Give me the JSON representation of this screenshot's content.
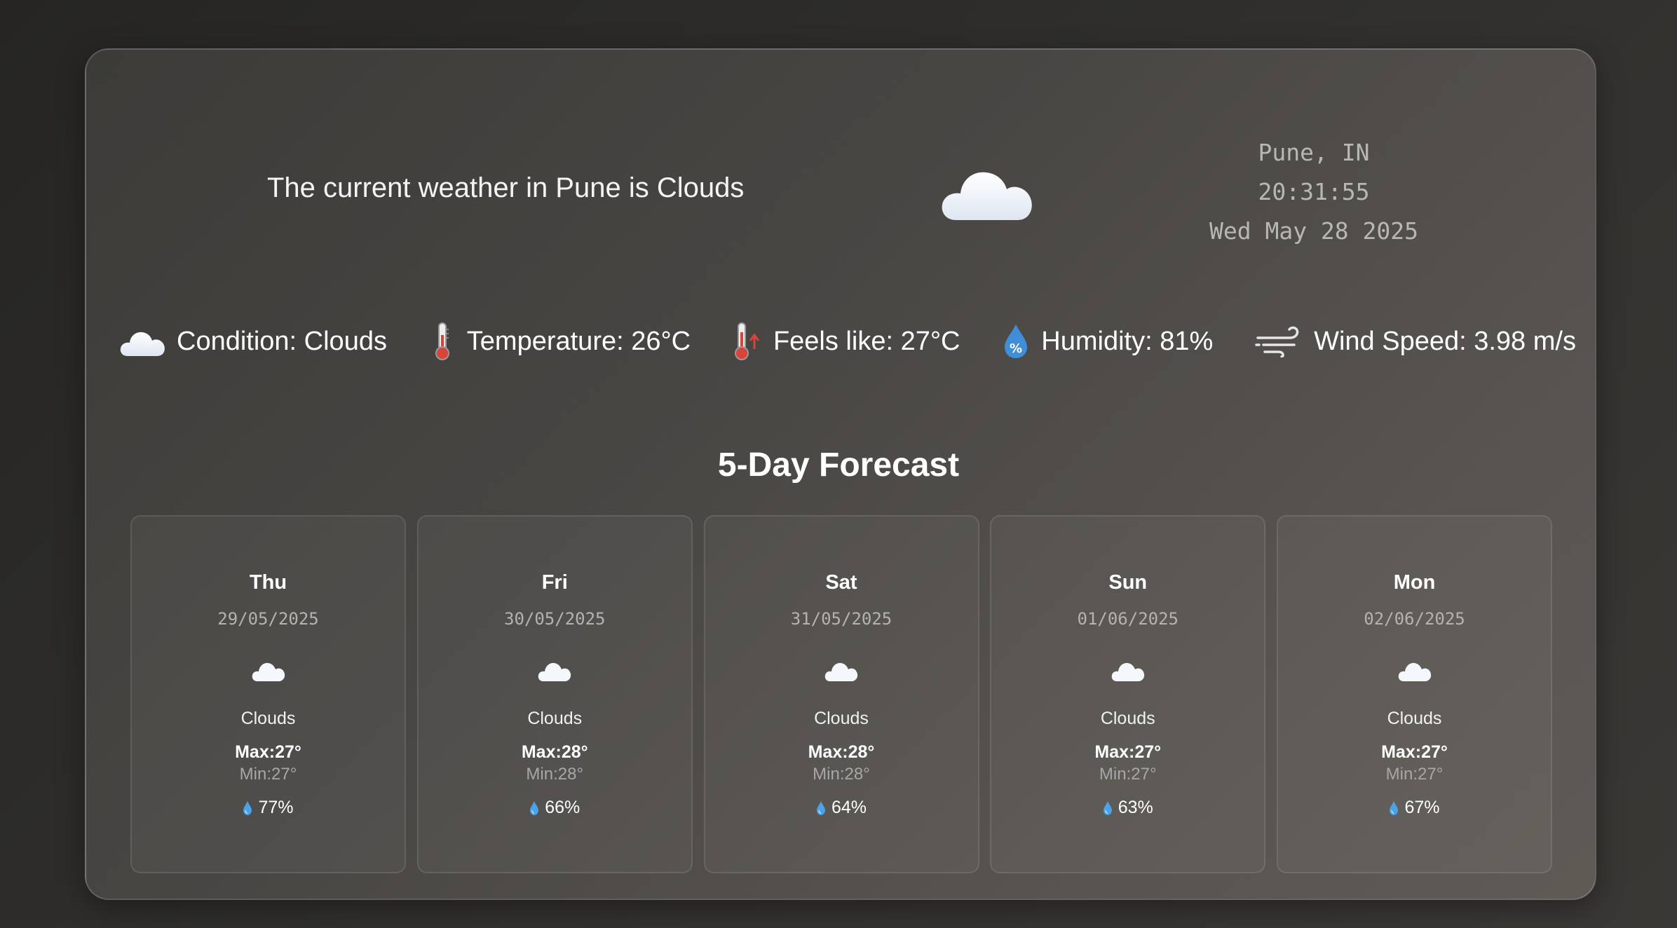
{
  "header": {
    "headline": "The current weather in Pune is Clouds",
    "hero_icon": "cloud-icon",
    "location": "Pune, IN",
    "time": "20:31:55",
    "date": "Wed May 28 2025"
  },
  "stats": {
    "condition": {
      "icon": "cloud-icon",
      "label": "Condition: Clouds"
    },
    "temperature": {
      "icon": "thermometer-icon",
      "label": "Temperature: 26°C"
    },
    "feels_like": {
      "icon": "thermometer-up-icon",
      "label": "Feels like: 27°C"
    },
    "humidity": {
      "icon": "humidity-drop-icon",
      "label": "Humidity: 81%"
    },
    "wind": {
      "icon": "wind-icon",
      "label": "Wind Speed: 3.98 m/s"
    }
  },
  "forecast": {
    "title": "5-Day Forecast",
    "days": [
      {
        "day": "Thu",
        "date": "29/05/2025",
        "icon": "cloud-icon",
        "condition": "Clouds",
        "max": "Max:27°",
        "min": "Min:27°",
        "humidity": "77%"
      },
      {
        "day": "Fri",
        "date": "30/05/2025",
        "icon": "cloud-icon",
        "condition": "Clouds",
        "max": "Max:28°",
        "min": "Min:28°",
        "humidity": "66%"
      },
      {
        "day": "Sat",
        "date": "31/05/2025",
        "icon": "cloud-icon",
        "condition": "Clouds",
        "max": "Max:28°",
        "min": "Min:28°",
        "humidity": "64%"
      },
      {
        "day": "Sun",
        "date": "01/06/2025",
        "icon": "cloud-icon",
        "condition": "Clouds",
        "max": "Max:27°",
        "min": "Min:27°",
        "humidity": "63%"
      },
      {
        "day": "Mon",
        "date": "02/06/2025",
        "icon": "cloud-icon",
        "condition": "Clouds",
        "max": "Max:27°",
        "min": "Min:27°",
        "humidity": "67%"
      }
    ]
  },
  "colors": {
    "background": "#2b2a28",
    "panel": "#4a4845",
    "clock_text": "#b9b7b4",
    "humidity_drop": "#3f8fd8",
    "thermometer_red": "#d9443a"
  }
}
